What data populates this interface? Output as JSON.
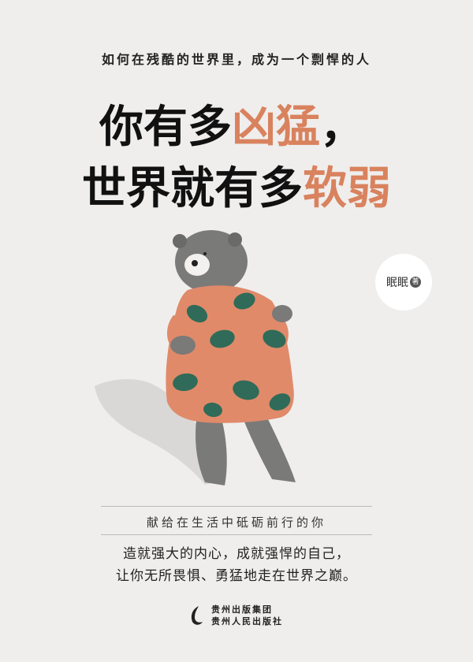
{
  "cover": {
    "tagline": "如何在残酷的世界里，成为一个剽悍的人",
    "title_line1_a": "你有多",
    "title_line1_b": "凶猛",
    "title_line1_c": "，",
    "title_line2_a": "世界就有多",
    "title_line2_b": "软弱",
    "author": "眠眠",
    "author_role": "著",
    "dedication": "献给在生活中砥砺前行的你",
    "blurb_line1": "造就强大的内心，成就强悍的自己，",
    "blurb_line2": "让你无所畏惧、勇猛地走在世界之巅。",
    "publisher_line1": "贵州出版集团",
    "publisher_line2": "贵州人民出版社"
  },
  "colors": {
    "background": "#efeeed",
    "accent": "#d9825e",
    "shirt": "#e08a6a",
    "leaf": "#2f6b58",
    "bear_fur": "#7a7a78"
  },
  "icons": {
    "illustration": "bear-in-leaf-shirt",
    "publisher_logo": "publisher-logo-icon"
  }
}
